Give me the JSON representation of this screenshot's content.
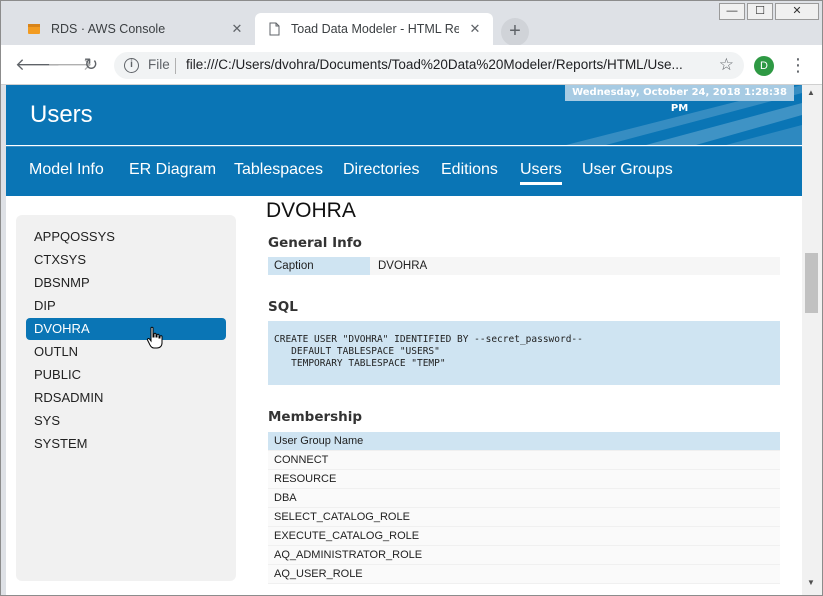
{
  "browser": {
    "tabs": [
      {
        "title": "RDS · AWS Console",
        "favicon": "box-icon",
        "active": false
      },
      {
        "title": "Toad Data Modeler - HTML Repc",
        "favicon": "page-icon",
        "active": true
      }
    ],
    "new_tab_label": "+",
    "address": {
      "scheme_label": "File",
      "url": "file:///C:/Users/dvohra/Documents/Toad%20Data%20Modeler/Reports/HTML/Use..."
    },
    "profile_initial": "D",
    "window_controls": {
      "minimize": "—",
      "maximize": "☐",
      "close": "✕"
    }
  },
  "page": {
    "title": "Users",
    "timestamp": "Wednesday, October 24, 2018 1:28:38 PM",
    "nav": [
      {
        "label": "Model Info",
        "active": false
      },
      {
        "label": "ER Diagram",
        "active": false
      },
      {
        "label": "Tablespaces",
        "active": false
      },
      {
        "label": "Directories",
        "active": false
      },
      {
        "label": "Editions",
        "active": false
      },
      {
        "label": "Users",
        "active": true
      },
      {
        "label": "User Groups",
        "active": false
      }
    ],
    "sidebar": {
      "items": [
        {
          "label": "APPQOSSYS",
          "active": false
        },
        {
          "label": "CTXSYS",
          "active": false
        },
        {
          "label": "DBSNMP",
          "active": false
        },
        {
          "label": "DIP",
          "active": false
        },
        {
          "label": "DVOHRA",
          "active": true
        },
        {
          "label": "OUTLN",
          "active": false
        },
        {
          "label": "PUBLIC",
          "active": false
        },
        {
          "label": "RDSADMIN",
          "active": false
        },
        {
          "label": "SYS",
          "active": false
        },
        {
          "label": "SYSTEM",
          "active": false
        }
      ]
    },
    "main": {
      "user_name": "DVOHRA",
      "general_info": {
        "heading": "General Info",
        "caption_label": "Caption",
        "caption_value": "DVOHRA"
      },
      "sql": {
        "heading": "SQL",
        "code": "CREATE USER \"DVOHRA\" IDENTIFIED BY --secret_password--\n   DEFAULT TABLESPACE \"USERS\"\n   TEMPORARY TABLESPACE \"TEMP\""
      },
      "membership": {
        "heading": "Membership",
        "column": "User Group Name",
        "rows": [
          "CONNECT",
          "RESOURCE",
          "DBA",
          "SELECT_CATALOG_ROLE",
          "EXECUTE_CATALOG_ROLE",
          "AQ_ADMINISTRATOR_ROLE",
          "AQ_USER_ROLE"
        ]
      }
    }
  },
  "colors": {
    "brand_blue": "#0a75b5",
    "light_blue": "#cfe4f2",
    "sidebar_bg": "#f1f1f1"
  }
}
